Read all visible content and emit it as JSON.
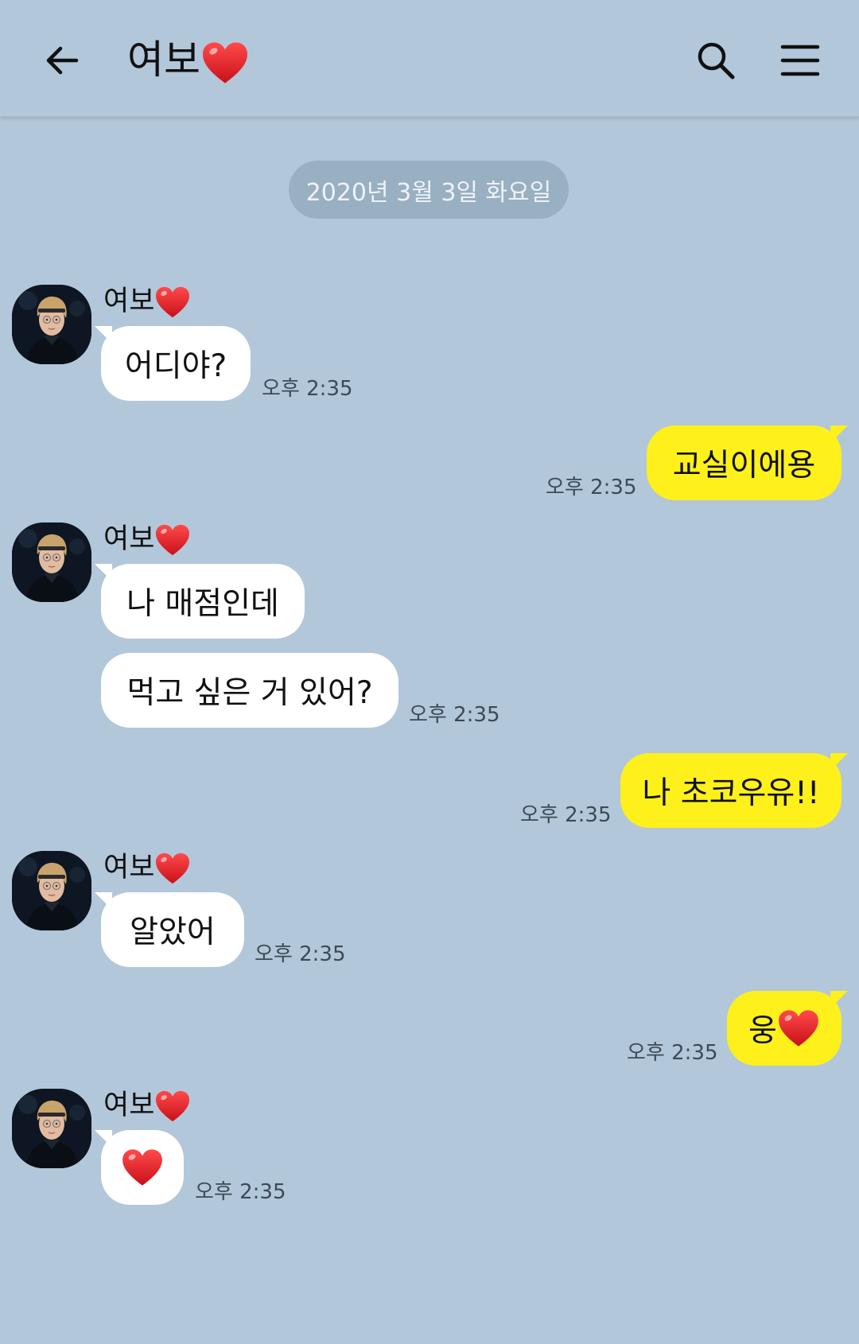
{
  "header": {
    "title": "여보",
    "back_icon": "arrow-left-icon",
    "search_icon": "search-icon",
    "menu_icon": "hamburger-menu-icon"
  },
  "date_divider": "2020년 3월 3일 화요일",
  "contact_name": "여보",
  "colors": {
    "background": "#b2c7da",
    "incoming_bubble": "#ffffff",
    "outgoing_bubble": "#fef01b",
    "heart": "#e0141e"
  },
  "messages": [
    {
      "direction": "incoming",
      "sender": "여보",
      "text": "어디야?",
      "time": "오후 2:35"
    },
    {
      "direction": "outgoing",
      "text": "교실이에용",
      "time": "오후 2:35"
    },
    {
      "direction": "incoming",
      "sender": "여보",
      "text": "나 매점인데"
    },
    {
      "direction": "incoming",
      "text": "먹고 싶은 거 있어?",
      "time": "오후 2:35"
    },
    {
      "direction": "outgoing",
      "text": "나 초코우유!!",
      "time": "오후 2:35"
    },
    {
      "direction": "incoming",
      "sender": "여보",
      "text": "알았어",
      "time": "오후 2:35"
    },
    {
      "direction": "outgoing",
      "text": "웅",
      "emoji": "heart-emoji",
      "time": "오후 2:35"
    },
    {
      "direction": "incoming",
      "sender": "여보",
      "text": "",
      "emoji": "heart-emoji",
      "time": "오후 2:35"
    }
  ]
}
